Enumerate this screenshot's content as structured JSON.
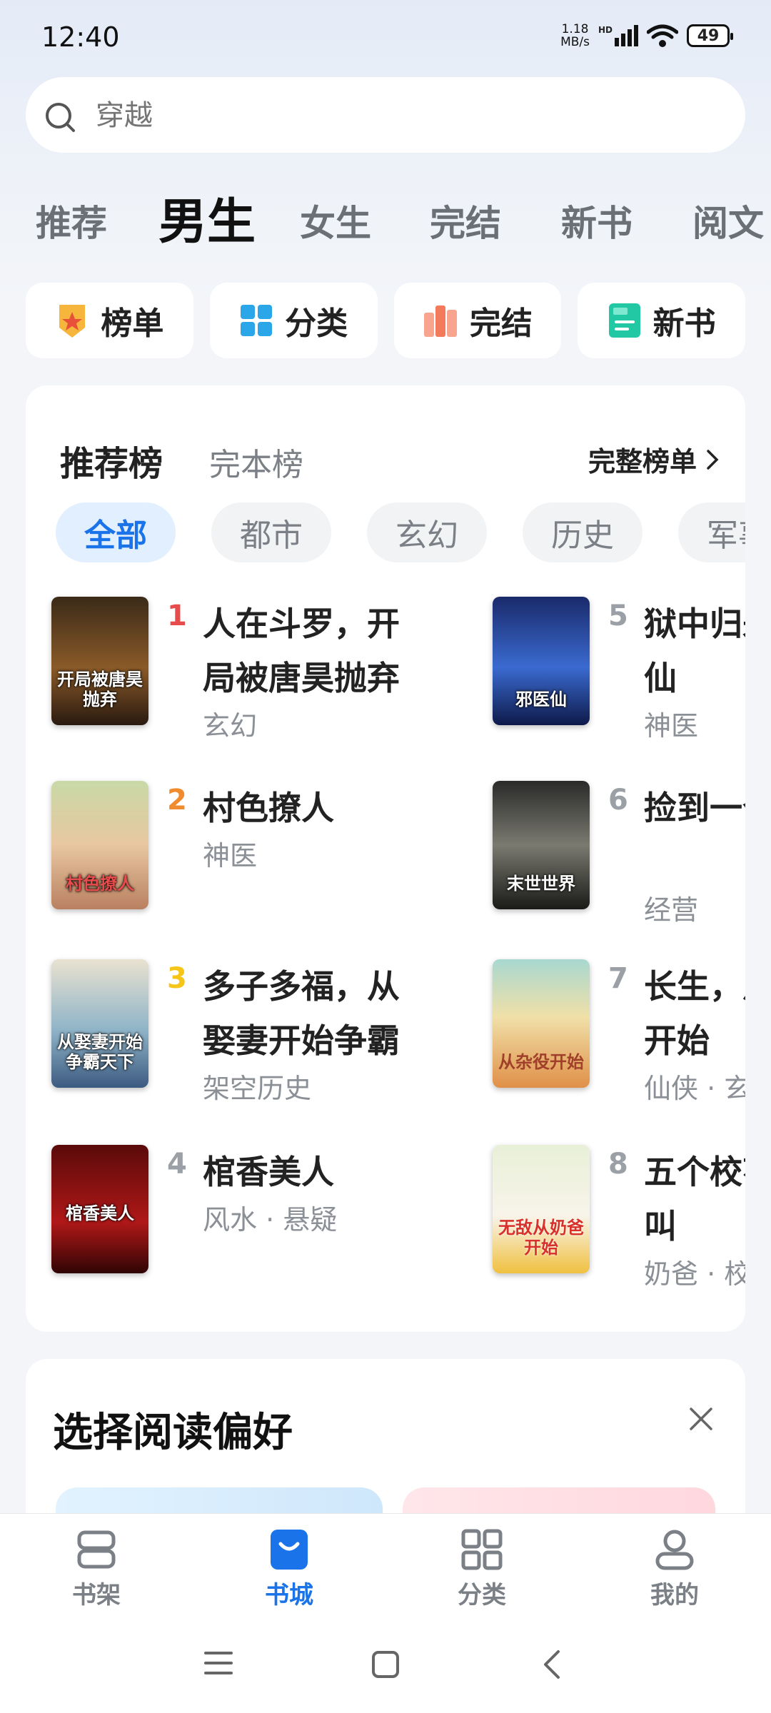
{
  "status_bar": {
    "time": "12:40",
    "net_speed_value": "1.18",
    "net_speed_unit": "MB/s",
    "hd": "HD",
    "battery": "49"
  },
  "search": {
    "placeholder": "穿越"
  },
  "tabs": [
    "推荐",
    "男生",
    "女生",
    "完结",
    "新书",
    "阅文"
  ],
  "active_tab": "男生",
  "shortcuts": [
    {
      "label": "榜单",
      "icon": "medal-icon",
      "color": "#f5b63b"
    },
    {
      "label": "分类",
      "icon": "grid-icon",
      "color": "#2ba6e8"
    },
    {
      "label": "完结",
      "icon": "books-icon",
      "color": "#f47a5c"
    },
    {
      "label": "新书",
      "icon": "new-badge-icon",
      "color": "#22c7a3"
    }
  ],
  "ranking": {
    "title": "推荐榜",
    "alt_title": "完本榜",
    "full_link": "完整榜单",
    "filters": [
      "全部",
      "都市",
      "玄幻",
      "历史",
      "军事"
    ],
    "books": [
      {
        "rank": "1",
        "title": "人在斗罗，开局被唐昊抛弃",
        "meta": "玄幻",
        "rank_color": "#e84b4b",
        "cover_text": "开局被唐昊抛弃"
      },
      {
        "rank": "2",
        "title": "村色撩人",
        "meta": "神医",
        "rank_color": "#f08c2e",
        "cover_text": "村色撩人"
      },
      {
        "rank": "3",
        "title": "多子多福，从娶妻开始争霸",
        "meta": "架空历史",
        "rank_color": "#f5c518",
        "cover_text": "从娶妻开始争霸天下"
      },
      {
        "rank": "4",
        "title": "棺香美人",
        "meta": "风水 · 悬疑",
        "rank_color": "#9aa0a6",
        "cover_text": "棺香美人"
      },
      {
        "rank": "5",
        "title": "狱中归来，医仙",
        "meta": "神医",
        "rank_color": "#9aa0a6",
        "cover_text": "邪医仙"
      },
      {
        "rank": "6",
        "title": "捡到一个世界",
        "meta": "经营",
        "rank_color": "#9aa0a6",
        "cover_text": "末世世界"
      },
      {
        "rank": "7",
        "title": "长生，从杂役开始",
        "meta": "仙侠 · 玄幻",
        "rank_color": "#9aa0a6",
        "cover_text": "从杂役开始"
      },
      {
        "rank": "8",
        "title": "五个校花堵门叫",
        "meta": "奶爸 · 校园",
        "rank_color": "#9aa0a6",
        "cover_text": "无敌从奶爸开始"
      }
    ]
  },
  "preferences": {
    "title": "选择阅读偏好"
  },
  "bottom_nav": [
    {
      "label": "书架",
      "icon": "bookshelf-icon"
    },
    {
      "label": "书城",
      "icon": "shopping-bag-icon"
    },
    {
      "label": "分类",
      "icon": "grid-icon"
    },
    {
      "label": "我的",
      "icon": "profile-icon"
    }
  ],
  "active_nav": "书城",
  "accent": "#1a73e8"
}
